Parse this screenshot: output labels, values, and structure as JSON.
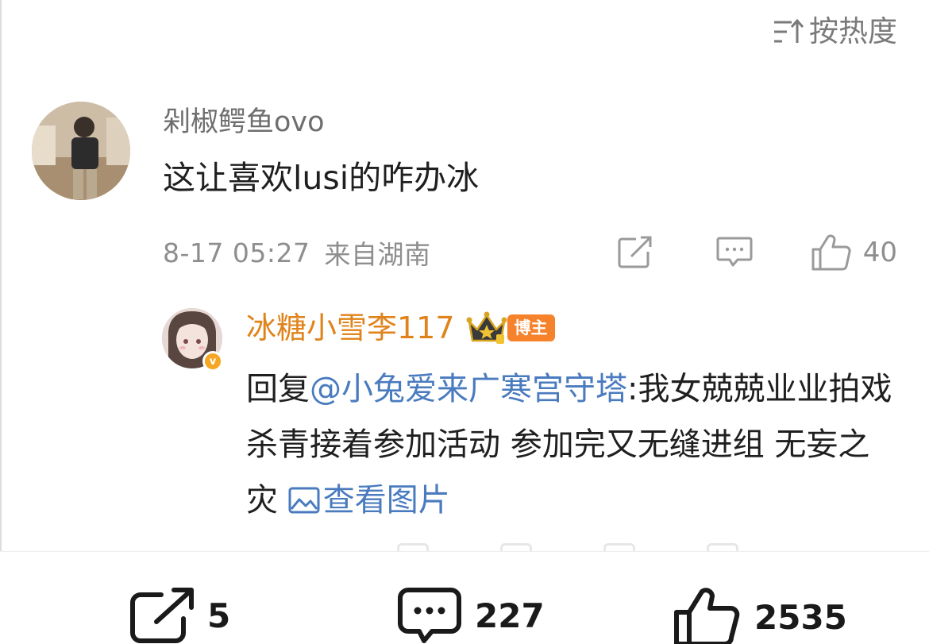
{
  "sort": {
    "label": "按热度"
  },
  "comment": {
    "username": "剁椒鳄鱼ovo",
    "content": "这让喜欢lusi的咋办冰",
    "time": "8-17 05:27",
    "location": "来自湖南",
    "like_count": "40"
  },
  "reply": {
    "username": "冰糖小雪李117",
    "badge": "博主",
    "prefix": "回复",
    "mention": "@小兔爱来广寒宫守塔",
    "text": ":我女兢兢业业拍戏 杀青接着参加活动 参加完又无缝进组 无妄之灾",
    "view_image_label": "查看图片"
  },
  "toolbar": {
    "share_count": "5",
    "comment_count": "227",
    "like_count": "2535"
  },
  "colors": {
    "reply_name": "#e0831a",
    "link": "#4a7bbf",
    "badge": "#f6822c",
    "meta": "#8e8e8e"
  }
}
